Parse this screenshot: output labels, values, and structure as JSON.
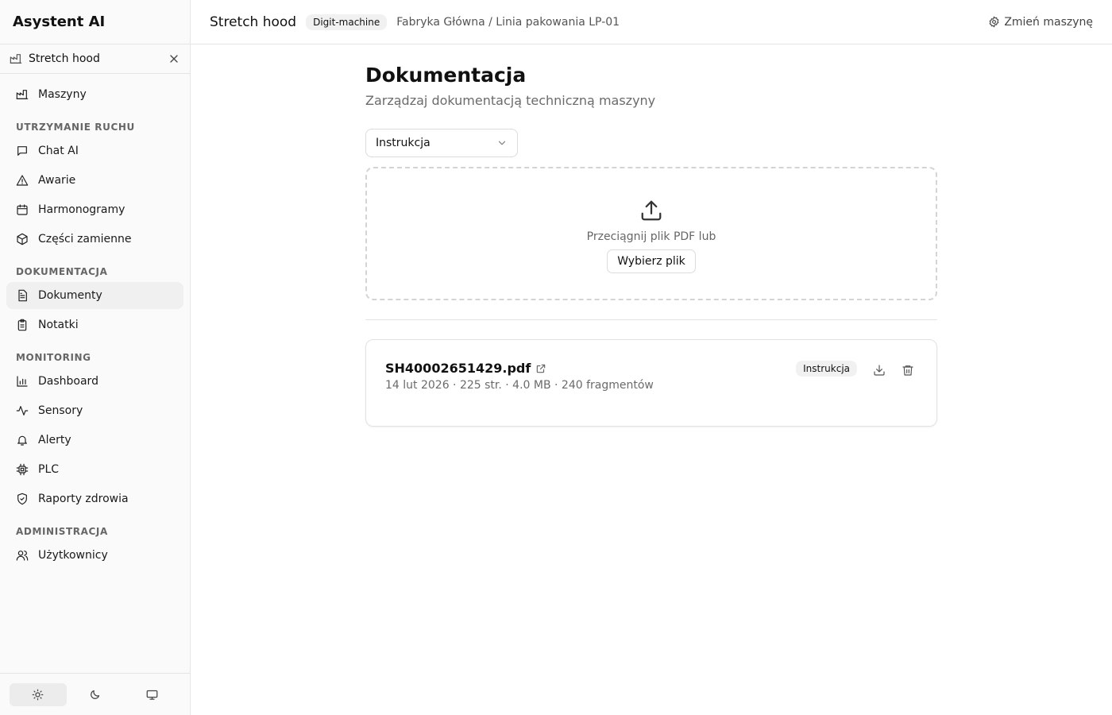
{
  "app": {
    "title": "Asystent AI"
  },
  "sidebar": {
    "machine_chip": {
      "label": "Stretch hood",
      "icon": "factory-icon",
      "close_icon": "close-icon"
    },
    "items_top": [
      {
        "label": "Maszyny",
        "icon": "factory-icon"
      }
    ],
    "sections": [
      {
        "title": "UTRZYMANIE RUCHU",
        "items": [
          {
            "label": "Chat AI",
            "icon": "chat-icon"
          },
          {
            "label": "Awarie",
            "icon": "warning-icon"
          },
          {
            "label": "Harmonogramy",
            "icon": "calendar-icon"
          },
          {
            "label": "Części zamienne",
            "icon": "package-icon"
          }
        ]
      },
      {
        "title": "DOKUMENTACJA",
        "items": [
          {
            "label": "Dokumenty",
            "icon": "document-icon",
            "active": true
          },
          {
            "label": "Notatki",
            "icon": "clipboard-icon"
          }
        ]
      },
      {
        "title": "MONITORING",
        "items": [
          {
            "label": "Dashboard",
            "icon": "bar-chart-icon"
          },
          {
            "label": "Sensory",
            "icon": "activity-icon"
          },
          {
            "label": "Alerty",
            "icon": "bell-icon"
          },
          {
            "label": "PLC",
            "icon": "cpu-icon"
          },
          {
            "label": "Raporty zdrowia",
            "icon": "shield-icon"
          }
        ]
      },
      {
        "title": "ADMINISTRACJA",
        "items": [
          {
            "label": "Użytkownicy",
            "icon": "users-icon"
          }
        ]
      }
    ],
    "theme": {
      "selected": "light",
      "options": [
        "sun-icon",
        "moon-icon",
        "monitor-icon"
      ]
    }
  },
  "topbar": {
    "machine_name": "Stretch hood",
    "badge": "Digit-machine",
    "path": "Fabryka Główna / Linia pakowania LP-01",
    "change_label": "Zmień maszynę"
  },
  "main": {
    "title": "Dokumentacja",
    "subtitle": "Zarządzaj dokumentacją techniczną maszyny",
    "type_select": {
      "value": "Instrukcja"
    },
    "dropzone": {
      "text": "Przeciągnij plik PDF lub",
      "button": "Wybierz plik"
    },
    "documents": [
      {
        "name": "SH40002651429.pdf",
        "meta": "14 lut 2026 · 225 str. · 4.0 MB · 240 fragmentów",
        "type": "Instrukcja"
      }
    ]
  },
  "colors": {
    "sidebar_bg": "#fafafa",
    "border": "#e5e5e5",
    "active_bg": "#f0f0f0",
    "muted_text": "#6b6b6b"
  }
}
